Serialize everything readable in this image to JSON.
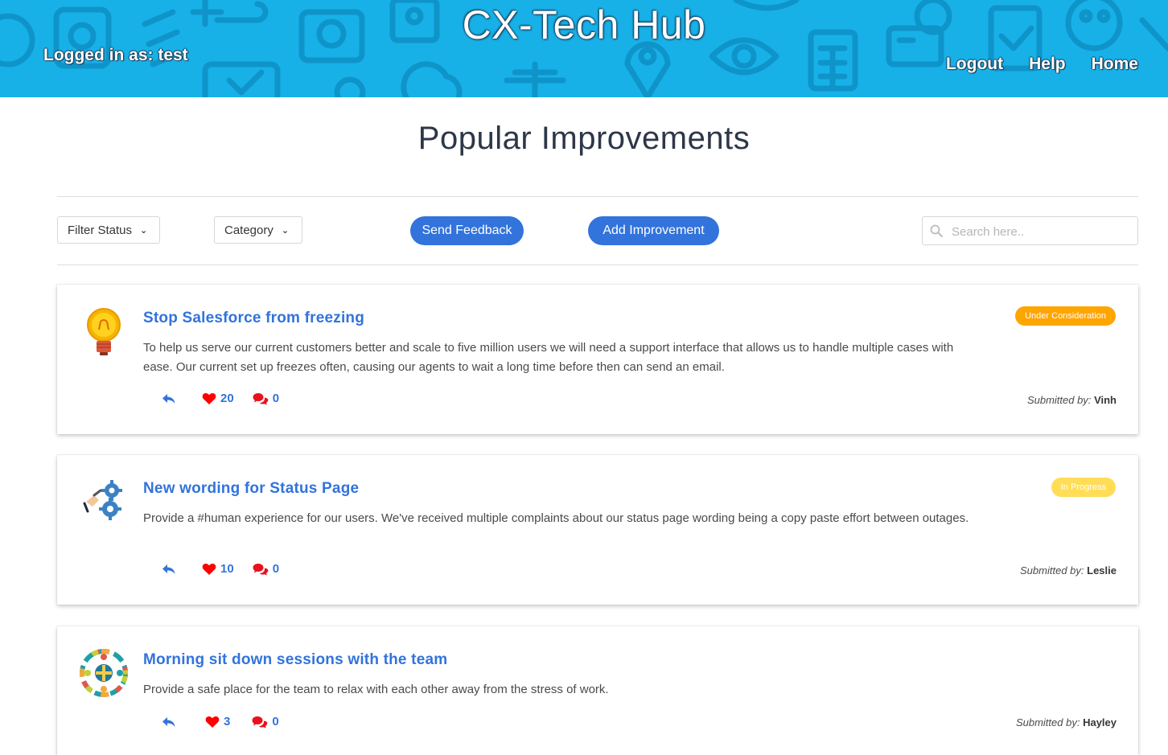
{
  "header": {
    "title": "CX-Tech Hub",
    "logged_in": "Logged in as: test",
    "nav": [
      "Logout",
      "Help",
      "Home"
    ]
  },
  "page_title": "Popular Improvements",
  "toolbar": {
    "filter_status": "Filter Status",
    "category": "Category",
    "send_feedback": "Send Feedback",
    "add_improvement": "Add Improvement",
    "search_placeholder": "Search here.."
  },
  "improvements": [
    {
      "title": "Stop Salesforce from freezing",
      "description": "To help us serve our current customers better and scale to five million users we will need a support interface that allows us to handle multiple cases with ease. Our current set up freezes often, causing our agents to wait a long time before then can send an email.",
      "likes": "20",
      "comments": "0",
      "status": "Under Consideration",
      "submitted_label": "Submitted by:",
      "submitted_by": "Vinh",
      "icon": "lightbulb-icon"
    },
    {
      "title": "New wording for Status Page",
      "description": "Provide a #human experience for our users. We've received multiple complaints about our status page wording being a copy paste effort between outages.",
      "likes": "10",
      "comments": "0",
      "status": "In Progress",
      "submitted_label": "Submitted by:",
      "submitted_by": "Leslie",
      "icon": "gears-icon"
    },
    {
      "title": "Morning sit down sessions with the team",
      "description": "Provide a safe place for the team to relax with each other away from the stress of work.",
      "likes": "3",
      "comments": "0",
      "submitted_label": "Submitted by:",
      "submitted_by": "Hayley",
      "icon": "team-circle-icon"
    }
  ],
  "colors": {
    "header_bg": "#17b1e8",
    "primary": "#3273dc",
    "heart": "#ff0000",
    "under_consideration": "#ffa500",
    "in_progress": "#ffdd57"
  }
}
